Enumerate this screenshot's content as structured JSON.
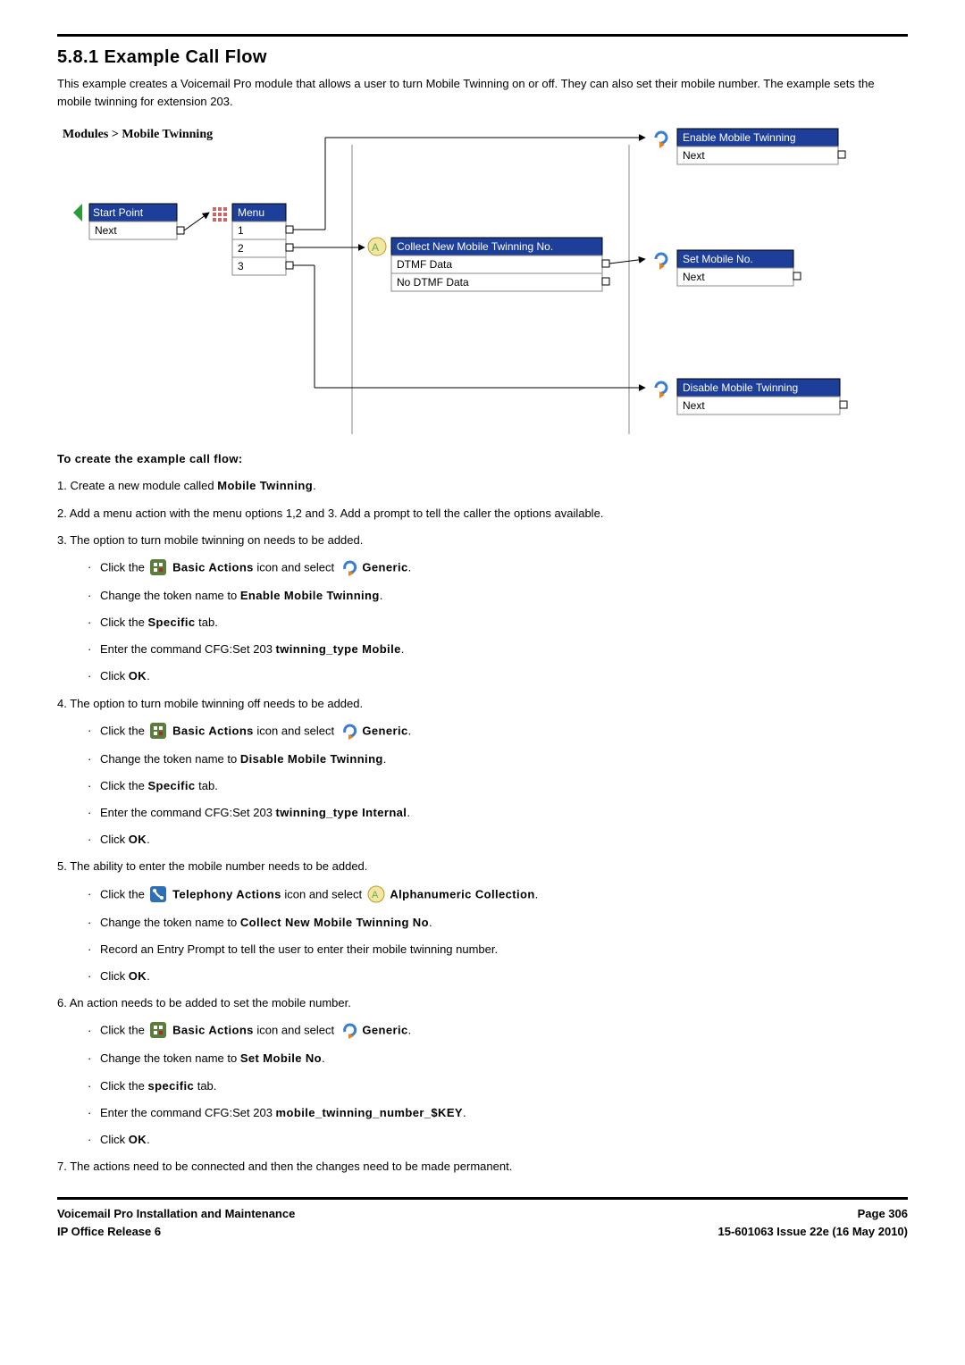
{
  "heading": "5.8.1 Example Call Flow",
  "intro": "This example creates a Voicemail Pro module that allows a user to turn Mobile Twinning on or off. They can also set their mobile number. The example sets the mobile twinning for extension 203.",
  "diagram": {
    "breadcrumb": "Modules > Mobile Twinning",
    "start": {
      "title": "Start Point",
      "row2": "Next"
    },
    "menu": {
      "title": "Menu",
      "options": [
        "1",
        "2",
        "3"
      ]
    },
    "collect": {
      "title": "Collect New Mobile Twinning No.",
      "row2": "DTMF Data",
      "row3": "No DTMF Data"
    },
    "enable": {
      "title": "Enable Mobile Twinning",
      "row2": "Next"
    },
    "setmobile": {
      "title": "Set Mobile No.",
      "row2": "Next"
    },
    "disable": {
      "title": "Disable Mobile Twinning",
      "row2": "Next"
    }
  },
  "lead": "To create the example call flow:",
  "steps": {
    "s1": {
      "n": "1.",
      "prefix": "Create a new module called ",
      "bold": "Mobile Twinning",
      "suffix": "."
    },
    "s2": {
      "n": "2.",
      "text": "Add a menu action with the menu options 1,2 and 3. Add a prompt to tell the caller the options available."
    },
    "s3": {
      "n": "3.",
      "text": "The option to turn mobile twinning on needs to be added.",
      "a": {
        "t1": "Click the ",
        "b1": "Basic Actions",
        "t2": " icon and select ",
        "b2": "Generic",
        "t3": "."
      },
      "b": {
        "t1": "Change the token name to ",
        "b1": "Enable Mobile Twinning",
        "t2": "."
      },
      "c": {
        "t1": "Click the ",
        "b1": "Specific",
        "t2": " tab."
      },
      "d": {
        "t1": "Enter the command CFG:Set 203 ",
        "b1": "twinning_type Mobile",
        "t2": "."
      },
      "e": {
        "t1": "Click ",
        "b1": "OK",
        "t2": "."
      }
    },
    "s4": {
      "n": "4.",
      "text": "The option to turn mobile twinning off needs to be added.",
      "a": {
        "t1": "Click the ",
        "b1": "Basic Actions",
        "t2": " icon and select ",
        "b2": "Generic",
        "t3": "."
      },
      "b": {
        "t1": "Change the token name to ",
        "b1": "Disable Mobile Twinning",
        "t2": "."
      },
      "c": {
        "t1": "Click the ",
        "b1": "Specific",
        "t2": " tab."
      },
      "d": {
        "t1": "Enter the command CFG:Set 203 ",
        "b1": "twinning_type Internal",
        "t2": "."
      },
      "e": {
        "t1": "Click ",
        "b1": "OK",
        "t2": "."
      }
    },
    "s5": {
      "n": "5.",
      "text": "The ability to enter the mobile number needs to be added.",
      "a": {
        "t1": "Click the ",
        "b1": "Telephony Actions",
        "t2": " icon and select ",
        "b2": "Alphanumeric Collection",
        "t3": "."
      },
      "b": {
        "t1": "Change the token name to ",
        "b1": "Collect New Mobile Twinning No",
        "t2": "."
      },
      "c": {
        "t1": "Record an Entry Prompt to tell the user to enter their mobile twinning number."
      },
      "d": {
        "t1": "Click ",
        "b1": "OK",
        "t2": "."
      }
    },
    "s6": {
      "n": "6.",
      "text": "An action needs to be added to set the mobile number.",
      "a": {
        "t1": "Click the ",
        "b1": "Basic Actions",
        "t2": " icon and select ",
        "b2": "Generic",
        "t3": "."
      },
      "b": {
        "t1": "Change the token name to ",
        "b1": "Set Mobile No",
        "t2": "."
      },
      "c": {
        "t1": "Click the ",
        "b1": "specific",
        "t2": " tab."
      },
      "d": {
        "t1": "Enter the command CFG:Set 203 ",
        "b1": "mobile_twinning_number_$KEY",
        "t2": "."
      },
      "e": {
        "t1": "Click ",
        "b1": "OK",
        "t2": "."
      }
    },
    "s7": {
      "n": "7.",
      "text": "The actions need to be connected and then the changes need to be made permanent."
    }
  },
  "footer": {
    "left1": "Voicemail Pro Installation and Maintenance",
    "left2": "IP Office Release 6",
    "right1": "Page 306",
    "right2": "15-601063 Issue 22e (16 May 2010)"
  }
}
